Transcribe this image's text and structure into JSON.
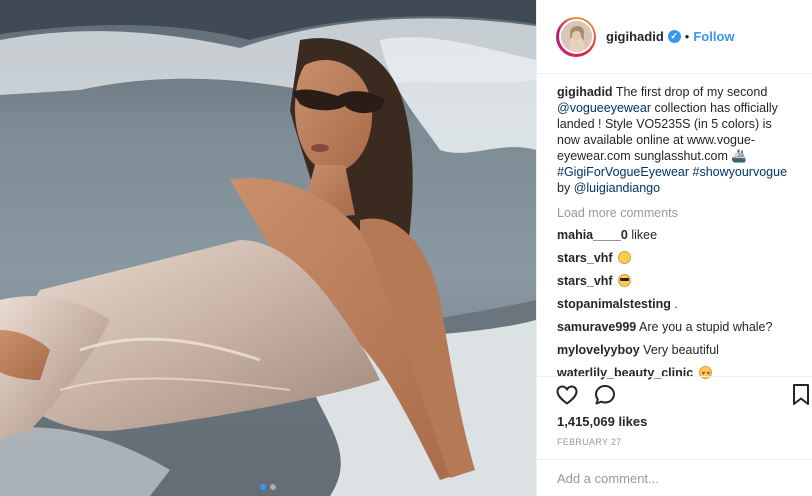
{
  "post": {
    "username": "gigihadid",
    "follow_label": "Follow",
    "separator": "•",
    "caption": {
      "username": "gigihadid",
      "t1": "The first drop of my second",
      "mention1": "@vogueeyewear",
      "t2": "collection has officially landed ! Style VO5235S (in 5 colors) is now available online at www.vogue-eyewear.com sunglasshut.com 🚢",
      "tag1": "#GigiForVogueEyewear",
      "tag2": "#showyourvogue",
      "t3": "by",
      "mention2": "@luigiandiango"
    },
    "load_more": "Load more comments",
    "comments": [
      {
        "user": "mahia____0",
        "text": "likee",
        "emoji": ""
      },
      {
        "user": "stars_vhf",
        "text": "",
        "emoji": "smile"
      },
      {
        "user": "stars_vhf",
        "text": "",
        "emoji": "cool"
      },
      {
        "user": "stopanimalstesting",
        "text": ".",
        "emoji": ""
      },
      {
        "user": "samurave999",
        "text": "Are you a stupid whale?",
        "emoji": ""
      },
      {
        "user": "mylovelyyboy",
        "text": "Very beautiful",
        "emoji": ""
      },
      {
        "user": "waterlily_beauty_clinic",
        "text": "",
        "emoji": "heart-eyes"
      }
    ],
    "likes": "1,415,069 likes",
    "date": "FEBRUARY 27",
    "add_comment_placeholder": "Add a comment...",
    "carousel": {
      "count": 2,
      "active": 1
    }
  },
  "icons": {
    "like": "heart-icon",
    "comment": "comment-bubble-icon",
    "save": "bookmark-icon",
    "verified": "verified-badge-icon"
  },
  "colors": {
    "link": "#003569",
    "follow": "#3897f0",
    "verified": "#3897f0",
    "muted": "#999999"
  }
}
